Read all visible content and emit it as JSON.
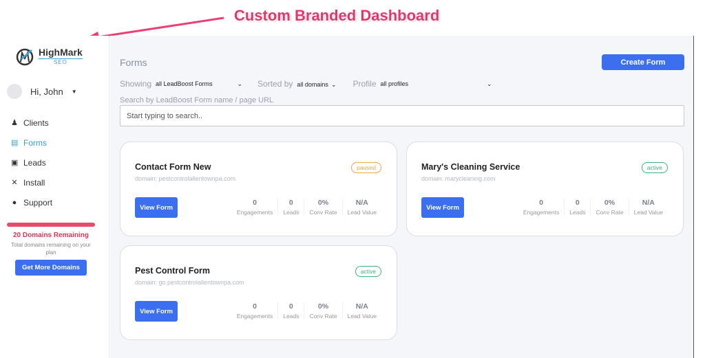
{
  "annotation": {
    "text": "Custom Branded Dashboard",
    "color": "#e8336d"
  },
  "sidebar": {
    "logo": {
      "name": "HighMark",
      "sub": "SEO"
    },
    "user": {
      "greeting": "Hi, John"
    },
    "items": [
      {
        "label": "Clients",
        "icon": "user-icon",
        "active": false
      },
      {
        "label": "Forms",
        "icon": "form-icon",
        "active": true
      },
      {
        "label": "Leads",
        "icon": "contact-card-icon",
        "active": false
      },
      {
        "label": "Install",
        "icon": "tools-icon",
        "active": false
      },
      {
        "label": "Support",
        "icon": "chat-icon",
        "active": false
      }
    ],
    "quota": {
      "title": "20 Domains Remaining",
      "subtitle": "Total domains remaining on your plan",
      "button": "Get More Domains"
    }
  },
  "main": {
    "title": "Forms",
    "create_button": "Create Form",
    "filters": {
      "showing_label": "Showing",
      "showing_value": "all LeadBoost Forms",
      "sorted_label": "Sorted by",
      "sorted_value": "all domains",
      "profile_label": "Profile",
      "profile_value": "all profiles"
    },
    "search": {
      "label": "Search by LeadBoost Form name / page URL",
      "placeholder": "Start typing to search.."
    },
    "cards": [
      {
        "title": "Contact Form New",
        "domain": "domain: pestcontrolallentownpa.com",
        "status": "paused",
        "button": "View Form",
        "stats": [
          {
            "value": "0",
            "label": "Engagements"
          },
          {
            "value": "0",
            "label": "Leads"
          },
          {
            "value": "0%",
            "label": "Conv Rate"
          },
          {
            "value": "N/A",
            "label": "Lead Value"
          }
        ]
      },
      {
        "title": "Mary's Cleaning Service",
        "domain": "domain: marycleaning.com",
        "status": "active",
        "button": "View Form",
        "stats": [
          {
            "value": "0",
            "label": "Engagements"
          },
          {
            "value": "0",
            "label": "Leads"
          },
          {
            "value": "0%",
            "label": "Conv Rate"
          },
          {
            "value": "N/A",
            "label": "Lead Value"
          }
        ]
      },
      {
        "title": "Pest Control Form",
        "domain": "domain: go.pestcontrolallentownpa.com",
        "status": "active",
        "button": "View Form",
        "stats": [
          {
            "value": "0",
            "label": "Engagements"
          },
          {
            "value": "0",
            "label": "Leads"
          },
          {
            "value": "0%",
            "label": "Conv Rate"
          },
          {
            "value": "N/A",
            "label": "Lead Value"
          }
        ]
      }
    ]
  }
}
